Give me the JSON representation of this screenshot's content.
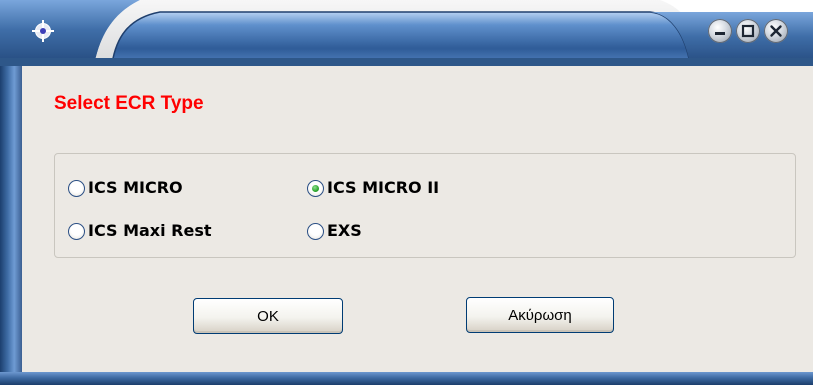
{
  "window": {
    "title": ""
  },
  "icons": {
    "app": "app-crosshair-icon",
    "minimize": "minimize-icon",
    "maximize": "maximize-icon",
    "close": "close-icon"
  },
  "dialog": {
    "heading": "Select ECR Type",
    "options": [
      {
        "label": "ICS MICRO",
        "checked": false
      },
      {
        "label": "ICS MICRO II",
        "checked": true
      },
      {
        "label": "ICS Maxi Rest",
        "checked": false
      },
      {
        "label": "EXS",
        "checked": false
      }
    ],
    "selected": "ICS MICRO II",
    "ok_label": "OK",
    "cancel_label": "Ακύρωση"
  },
  "colors": {
    "heading": "#ff0000",
    "client_background": "#ece9e4",
    "frame_blue": "#3f6da6",
    "radio_check": "#2fa82f"
  }
}
